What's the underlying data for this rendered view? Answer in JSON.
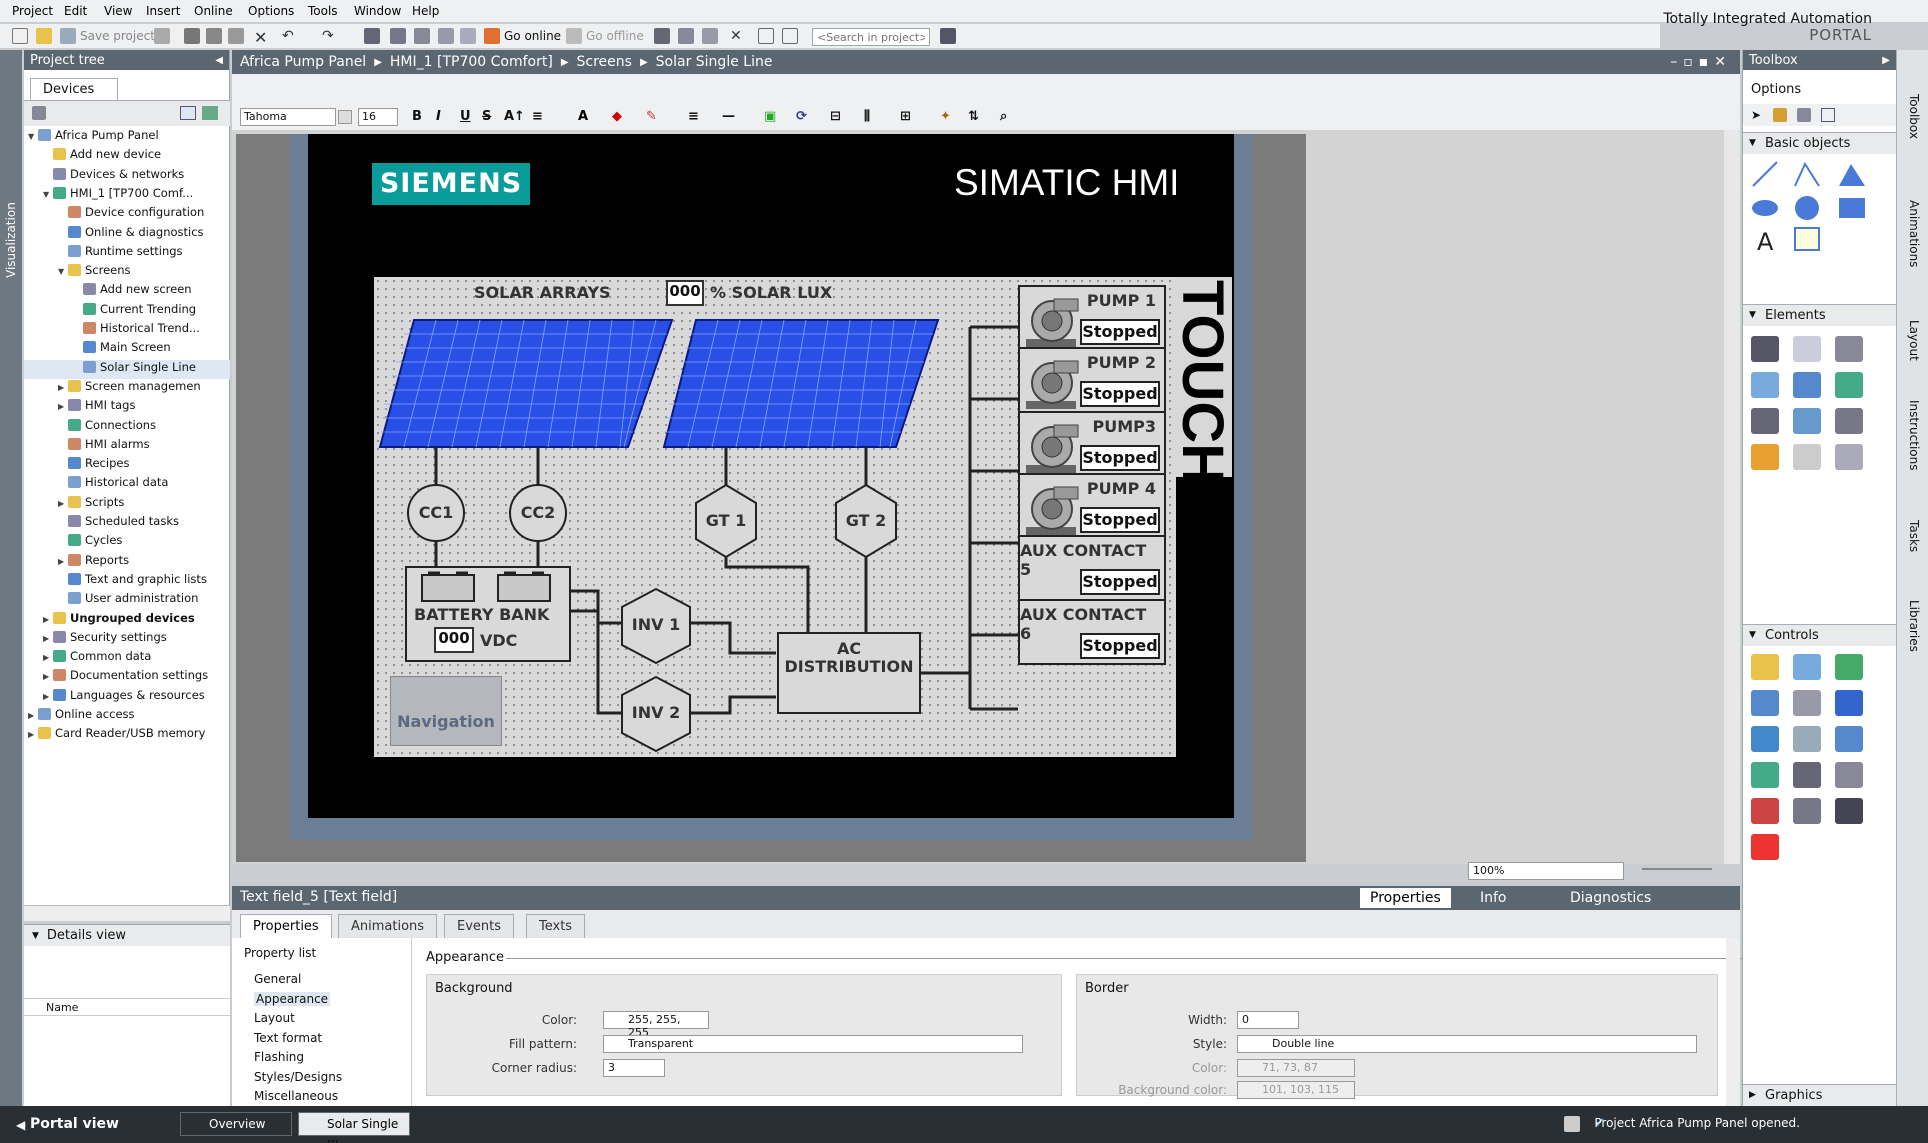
{
  "menu": [
    "Project",
    "Edit",
    "View",
    "Insert",
    "Online",
    "Options",
    "Tools",
    "Window",
    "Help"
  ],
  "portal": {
    "title": "Totally Integrated Automation",
    "subtitle": "PORTAL"
  },
  "toolbar": {
    "save_project": "Save project",
    "go_online": "Go online",
    "go_offline": "Go offline",
    "search_placeholder": "<Search in project>"
  },
  "sidebar_left_label": "Visualization",
  "project_tree": {
    "title": "Project tree",
    "tab": "Devices",
    "items": [
      {
        "label": "Africa Pump Panel",
        "level": 0,
        "expand": "▼"
      },
      {
        "label": "Add new device",
        "level": 1,
        "expand": ""
      },
      {
        "label": "Devices & networks",
        "level": 1,
        "expand": ""
      },
      {
        "label": "HMI_1 [TP700 Comf...",
        "level": 1,
        "expand": "▼"
      },
      {
        "label": "Device configuration",
        "level": 2,
        "expand": ""
      },
      {
        "label": "Online & diagnostics",
        "level": 2,
        "expand": ""
      },
      {
        "label": "Runtime settings",
        "level": 2,
        "expand": ""
      },
      {
        "label": "Screens",
        "level": 2,
        "expand": "▼"
      },
      {
        "label": "Add new screen",
        "level": 3,
        "expand": ""
      },
      {
        "label": "Current Trending",
        "level": 3,
        "expand": ""
      },
      {
        "label": "Historical Trend...",
        "level": 3,
        "expand": ""
      },
      {
        "label": "Main Screen",
        "level": 3,
        "expand": ""
      },
      {
        "label": "Solar Single Line",
        "level": 3,
        "expand": "",
        "selected": true
      },
      {
        "label": "Screen managemen",
        "level": 2,
        "expand": "▶"
      },
      {
        "label": "HMI tags",
        "level": 2,
        "expand": "▶"
      },
      {
        "label": "Connections",
        "level": 2,
        "expand": ""
      },
      {
        "label": "HMI alarms",
        "level": 2,
        "expand": ""
      },
      {
        "label": "Recipes",
        "level": 2,
        "expand": ""
      },
      {
        "label": "Historical data",
        "level": 2,
        "expand": ""
      },
      {
        "label": "Scripts",
        "level": 2,
        "expand": "▶"
      },
      {
        "label": "Scheduled tasks",
        "level": 2,
        "expand": ""
      },
      {
        "label": "Cycles",
        "level": 2,
        "expand": ""
      },
      {
        "label": "Reports",
        "level": 2,
        "expand": "▶"
      },
      {
        "label": "Text and graphic lists",
        "level": 2,
        "expand": ""
      },
      {
        "label": "User administration",
        "level": 2,
        "expand": ""
      },
      {
        "label": "Ungrouped devices",
        "level": 1,
        "expand": "▶",
        "bold": true
      },
      {
        "label": "Security settings",
        "level": 1,
        "expand": "▶"
      },
      {
        "label": "Common data",
        "level": 1,
        "expand": "▶"
      },
      {
        "label": "Documentation settings",
        "level": 1,
        "expand": "▶"
      },
      {
        "label": "Languages & resources",
        "level": 1,
        "expand": "▶"
      },
      {
        "label": "Online access",
        "level": 0,
        "expand": "▶"
      },
      {
        "label": "Card Reader/USB memory",
        "level": 0,
        "expand": "▶"
      }
    ]
  },
  "details": {
    "title": "Details view",
    "col_name": "Name"
  },
  "editor": {
    "breadcrumb": [
      "Africa Pump Panel",
      "HMI_1 [TP700 Comfort]",
      "Screens",
      "Solar Single Line"
    ],
    "font": "Tahoma",
    "font_size": "16",
    "zoom": "100%"
  },
  "hmi": {
    "brand": "SIEMENS",
    "title": "SIMATIC HMI",
    "touch": "TOUCH",
    "solar_arrays": "SOLAR ARRAYS",
    "lux_value": "000",
    "lux_label": "% SOLAR LUX",
    "cc1": "CC1",
    "cc2": "CC2",
    "gt1": "GT 1",
    "gt2": "GT 2",
    "inv1": "INV 1",
    "inv2": "INV 2",
    "battery_label": "BATTERY BANK",
    "battery_value": "000",
    "battery_unit": "VDC",
    "ac_line1": "AC",
    "ac_line2": "DISTRIBUTION",
    "nav": "Navigation",
    "pumps": [
      {
        "name": "PUMP 1",
        "status": "Stopped",
        "icon": true
      },
      {
        "name": "PUMP 2",
        "status": "Stopped",
        "icon": true
      },
      {
        "name": "PUMP3",
        "status": "Stopped",
        "icon": true
      },
      {
        "name": "PUMP 4",
        "status": "Stopped",
        "icon": true
      },
      {
        "name": "AUX CONTACT 5",
        "status": "Stopped",
        "icon": false
      },
      {
        "name": "AUX CONTACT 6",
        "status": "Stopped",
        "icon": false
      }
    ]
  },
  "properties": {
    "object_title": "Text field_5 [Text field]",
    "right_tabs": [
      "Properties",
      "Info",
      "Diagnostics"
    ],
    "tabs": [
      "Properties",
      "Animations",
      "Events",
      "Texts"
    ],
    "property_list_label": "Property list",
    "list": [
      "General",
      "Appearance",
      "Layout",
      "Text format",
      "Flashing",
      "Styles/Designs",
      "Miscellaneous"
    ],
    "section": "Appearance",
    "background": {
      "title": "Background",
      "color_label": "Color:",
      "color_value": "255, 255, 255",
      "fill_label": "Fill pattern:",
      "fill_value": "Transparent",
      "corner_label": "Corner radius:",
      "corner_value": "3"
    },
    "border": {
      "title": "Border",
      "width_label": "Width:",
      "width_value": "0",
      "style_label": "Style:",
      "style_value": "Double line",
      "color_label": "Color:",
      "color_value": "71, 73, 87",
      "bg_label": "Background color:",
      "bg_value": "101, 103, 115"
    }
  },
  "toolbox": {
    "title": "Toolbox",
    "options": "Options",
    "sections": [
      "Basic objects",
      "Elements",
      "Controls",
      "Graphics"
    ],
    "side_tabs": [
      "Toolbox",
      "Animations",
      "Layout",
      "Instructions",
      "Tasks",
      "Libraries"
    ]
  },
  "statusbar": {
    "portal_view": "Portal view",
    "tabs": [
      "Overview",
      "Solar Single ..."
    ],
    "message": "Project Africa Pump Panel opened."
  },
  "colors": {
    "header": "#5a6670",
    "teal": "#0a9b9b",
    "panel_blue": "#2850e6"
  }
}
